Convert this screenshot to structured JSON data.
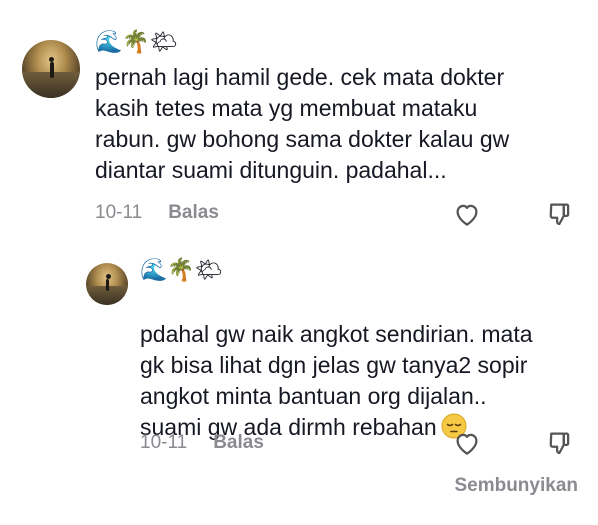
{
  "comments": [
    {
      "username": "🌊🌴🌤",
      "text": "pernah lagi hamil gede. cek mata dokter\nkasih tetes mata yg membuat mataku\nrabun. gw bohong sama dokter kalau gw\ndiantar suami ditunguin. padahal...",
      "date": "10-11",
      "reply_label": "Balas",
      "like_icon": "heart-outline-icon",
      "dislike_icon": "thumbs-down-icon"
    },
    {
      "username": "🌊🌴🌤",
      "text": "pdahal gw naik angkot sendirian. mata\ngk bisa lihat dgn jelas gw tanya2 sopir\nangkot minta bantuan org dijalan..\nsuami gw ada dirmh rebahan",
      "trailing_emoji": "😔",
      "date": "10-11",
      "reply_label": "Balas",
      "like_icon": "heart-outline-icon",
      "dislike_icon": "thumbs-down-icon"
    }
  ],
  "hide_label": "Sembunyikan",
  "colors": {
    "text": "#161823",
    "meta": "#8a8b91",
    "icon": "#555555"
  }
}
